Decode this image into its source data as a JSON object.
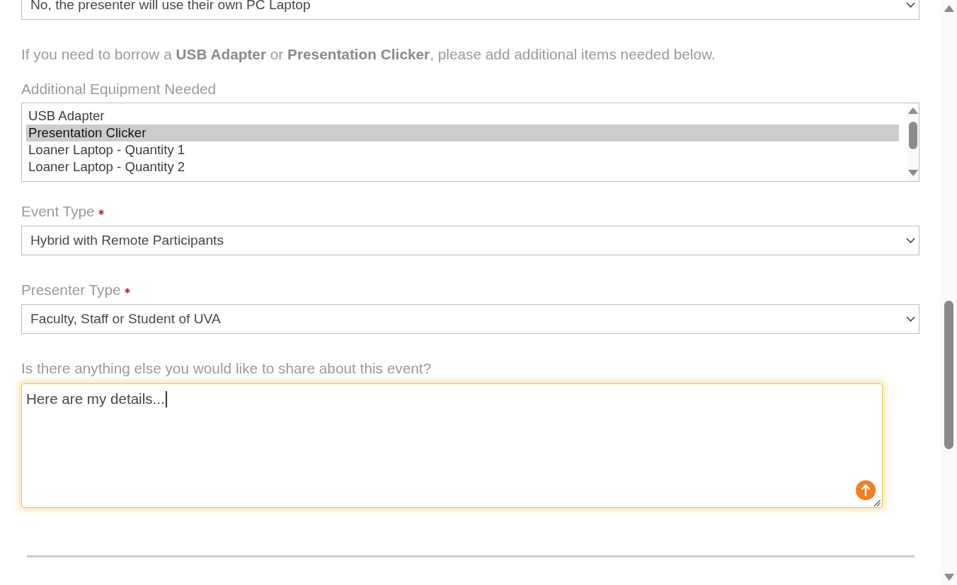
{
  "form": {
    "fields": [
      {
        "kind": "select",
        "value": "No, the presenter will use their own PC Laptop"
      },
      {
        "kind": "note",
        "text": "If you need to borrow a **USB Adapter** or **Presentation Clicker**, please add additional items needed below."
      },
      {
        "kind": "listbox",
        "label": "Additional Equipment Needed",
        "options": [
          {
            "label": "USB Adapter",
            "selected": false
          },
          {
            "label": "Presentation Clicker",
            "selected": true
          },
          {
            "label": "Loaner Laptop - Quantity 1",
            "selected": false
          },
          {
            "label": "Loaner Laptop - Quantity 2",
            "selected": false
          }
        ]
      },
      {
        "kind": "select",
        "label": "Event Type",
        "required": true,
        "value": "Hybrid with Remote Participants"
      },
      {
        "kind": "select",
        "label": "Presenter Type",
        "required": true,
        "value": "Faculty, Staff or Student of UVA"
      },
      {
        "kind": "textarea",
        "label": "Is there anything else you would like to share about this event?",
        "value": "Here are my details...",
        "focused": true
      }
    ]
  }
}
